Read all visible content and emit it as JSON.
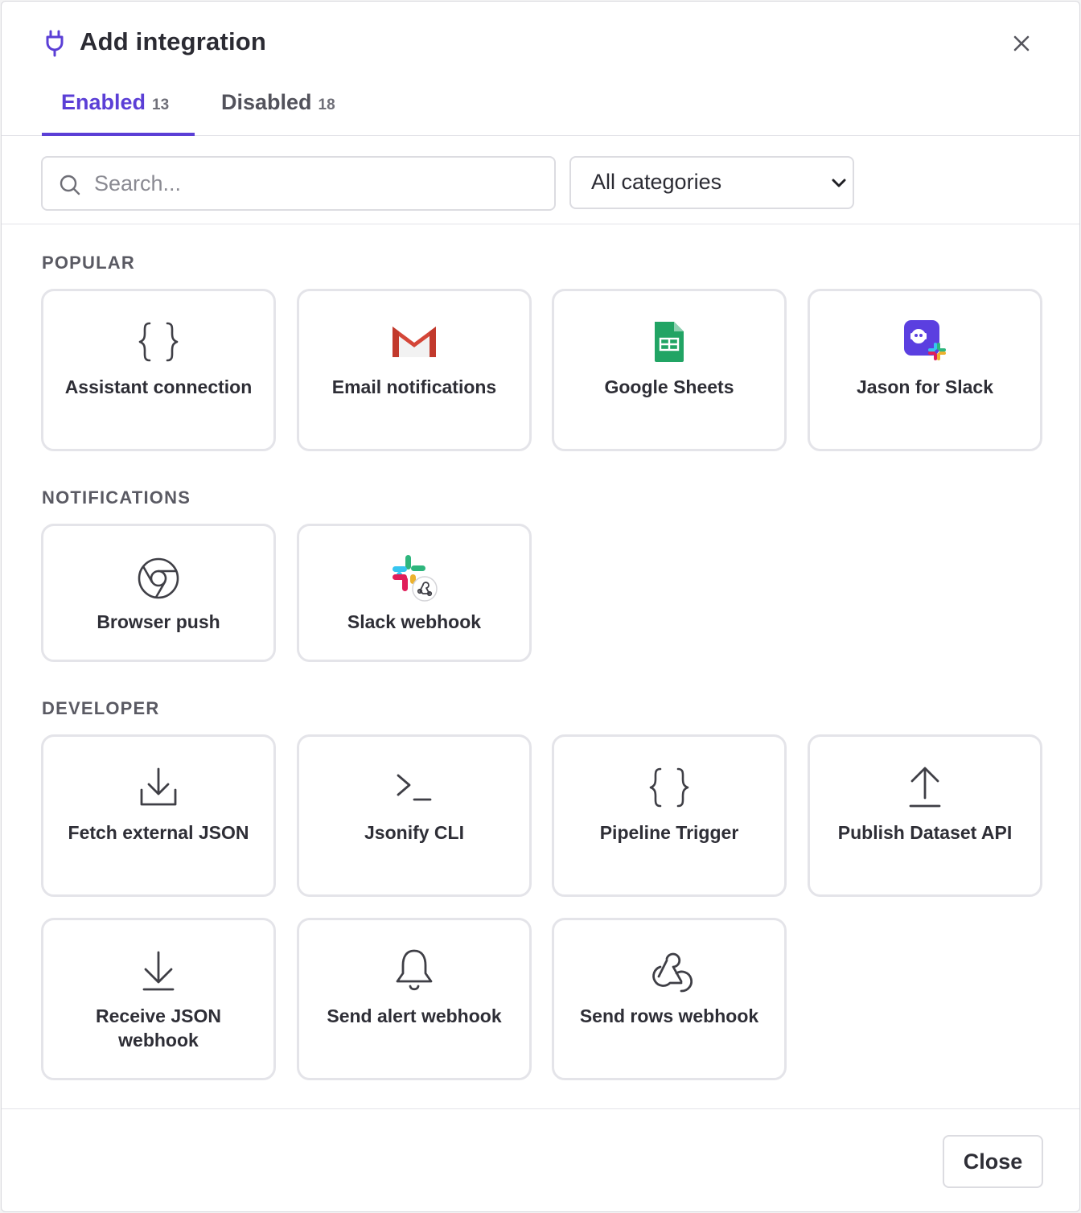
{
  "dialog": {
    "title": "Add integration",
    "close_label": "Close"
  },
  "tabs": [
    {
      "label": "Enabled",
      "count": "13",
      "active": true
    },
    {
      "label": "Disabled",
      "count": "18",
      "active": false
    }
  ],
  "search": {
    "placeholder": "Search...",
    "value": ""
  },
  "category_filter": {
    "selected": "All categories"
  },
  "colors": {
    "accent": "#5b3fd6",
    "border": "#e4e4e9",
    "text": "#2e2e36"
  },
  "sections": [
    {
      "title": "POPULAR",
      "items": [
        {
          "label": "Assistant connection",
          "icon": "braces-icon"
        },
        {
          "label": "Email notifications",
          "icon": "gmail-icon"
        },
        {
          "label": "Google Sheets",
          "icon": "google-sheets-icon"
        },
        {
          "label": "Jason for Slack",
          "icon": "jason-slack-icon"
        }
      ]
    },
    {
      "title": "NOTIFICATIONS",
      "items": [
        {
          "label": "Browser push",
          "icon": "chrome-icon"
        },
        {
          "label": "Slack webhook",
          "icon": "slack-webhook-icon"
        }
      ]
    },
    {
      "title": "DEVELOPER",
      "items": [
        {
          "label": "Fetch external JSON",
          "icon": "download-icon"
        },
        {
          "label": "Jsonify CLI",
          "icon": "terminal-icon"
        },
        {
          "label": "Pipeline Trigger",
          "icon": "braces-icon"
        },
        {
          "label": "Publish Dataset API",
          "icon": "upload-icon"
        },
        {
          "label": "Receive JSON webhook",
          "icon": "arrow-down-icon"
        },
        {
          "label": "Send alert webhook",
          "icon": "bell-icon"
        },
        {
          "label": "Send rows webhook",
          "icon": "webhook-icon"
        }
      ]
    }
  ]
}
